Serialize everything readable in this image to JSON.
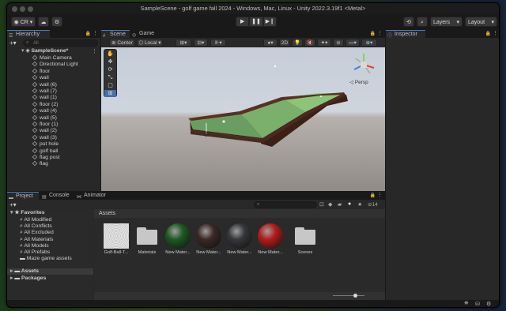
{
  "window": {
    "title": "SampleScene - golf game fall 2024 - Windows, Mac, Linux - Unity 2022.3.19f1 <Metal>"
  },
  "toolbar": {
    "account_label": "CR",
    "layers_label": "Layers",
    "layout_label": "Layout",
    "play_icon": "play-icon",
    "pause_icon": "pause-icon",
    "step_icon": "step-icon"
  },
  "hierarchy": {
    "tab_label": "Hierarchy",
    "search_placeholder": "All",
    "scene_name": "SampleScene*",
    "items": [
      "Main Camera",
      "Directional Light",
      "floor",
      "wall",
      "wall (6)",
      "wall (7)",
      "wall (1)",
      "floor (2)",
      "wall (4)",
      "wall (5)",
      "floor (1)",
      "wall (2)",
      "wall (3)",
      "put hole",
      "golf ball",
      "flag post",
      "flag"
    ]
  },
  "scene": {
    "tabs": [
      "Scene",
      "Game"
    ],
    "pivot_label": "Center",
    "space_label": "Local",
    "mode_2d_label": "2D",
    "persp_label": "Persp"
  },
  "inspector": {
    "tab_label": "Inspector"
  },
  "project": {
    "tabs": [
      "Project",
      "Console",
      "Animator"
    ],
    "favorites_label": "Favorites",
    "favorites": [
      "All Modified",
      "All Conflicts",
      "All Excluded",
      "All Materials",
      "All Models",
      "All Prefabs",
      "Maze game assets"
    ],
    "tree": [
      "Assets",
      "Packages"
    ],
    "breadcrumb": "Assets",
    "hidden_count": "14",
    "assets": [
      {
        "name": "Golf-Ball-T...",
        "kind": "texture"
      },
      {
        "name": "Materials",
        "kind": "folder"
      },
      {
        "name": "New Mater...",
        "kind": "material",
        "color": "#1f5a22"
      },
      {
        "name": "New Mater...",
        "kind": "material",
        "color": "#3b2826"
      },
      {
        "name": "New Mater...",
        "kind": "material",
        "color": "#35373b"
      },
      {
        "name": "New Mater...",
        "kind": "material",
        "color": "#b51c1a"
      },
      {
        "name": "Scenes",
        "kind": "folder"
      }
    ]
  },
  "colors": {
    "accent": "#3d7ad6",
    "green_surface": "#5d9b5e",
    "wall": "#4a2c22"
  }
}
